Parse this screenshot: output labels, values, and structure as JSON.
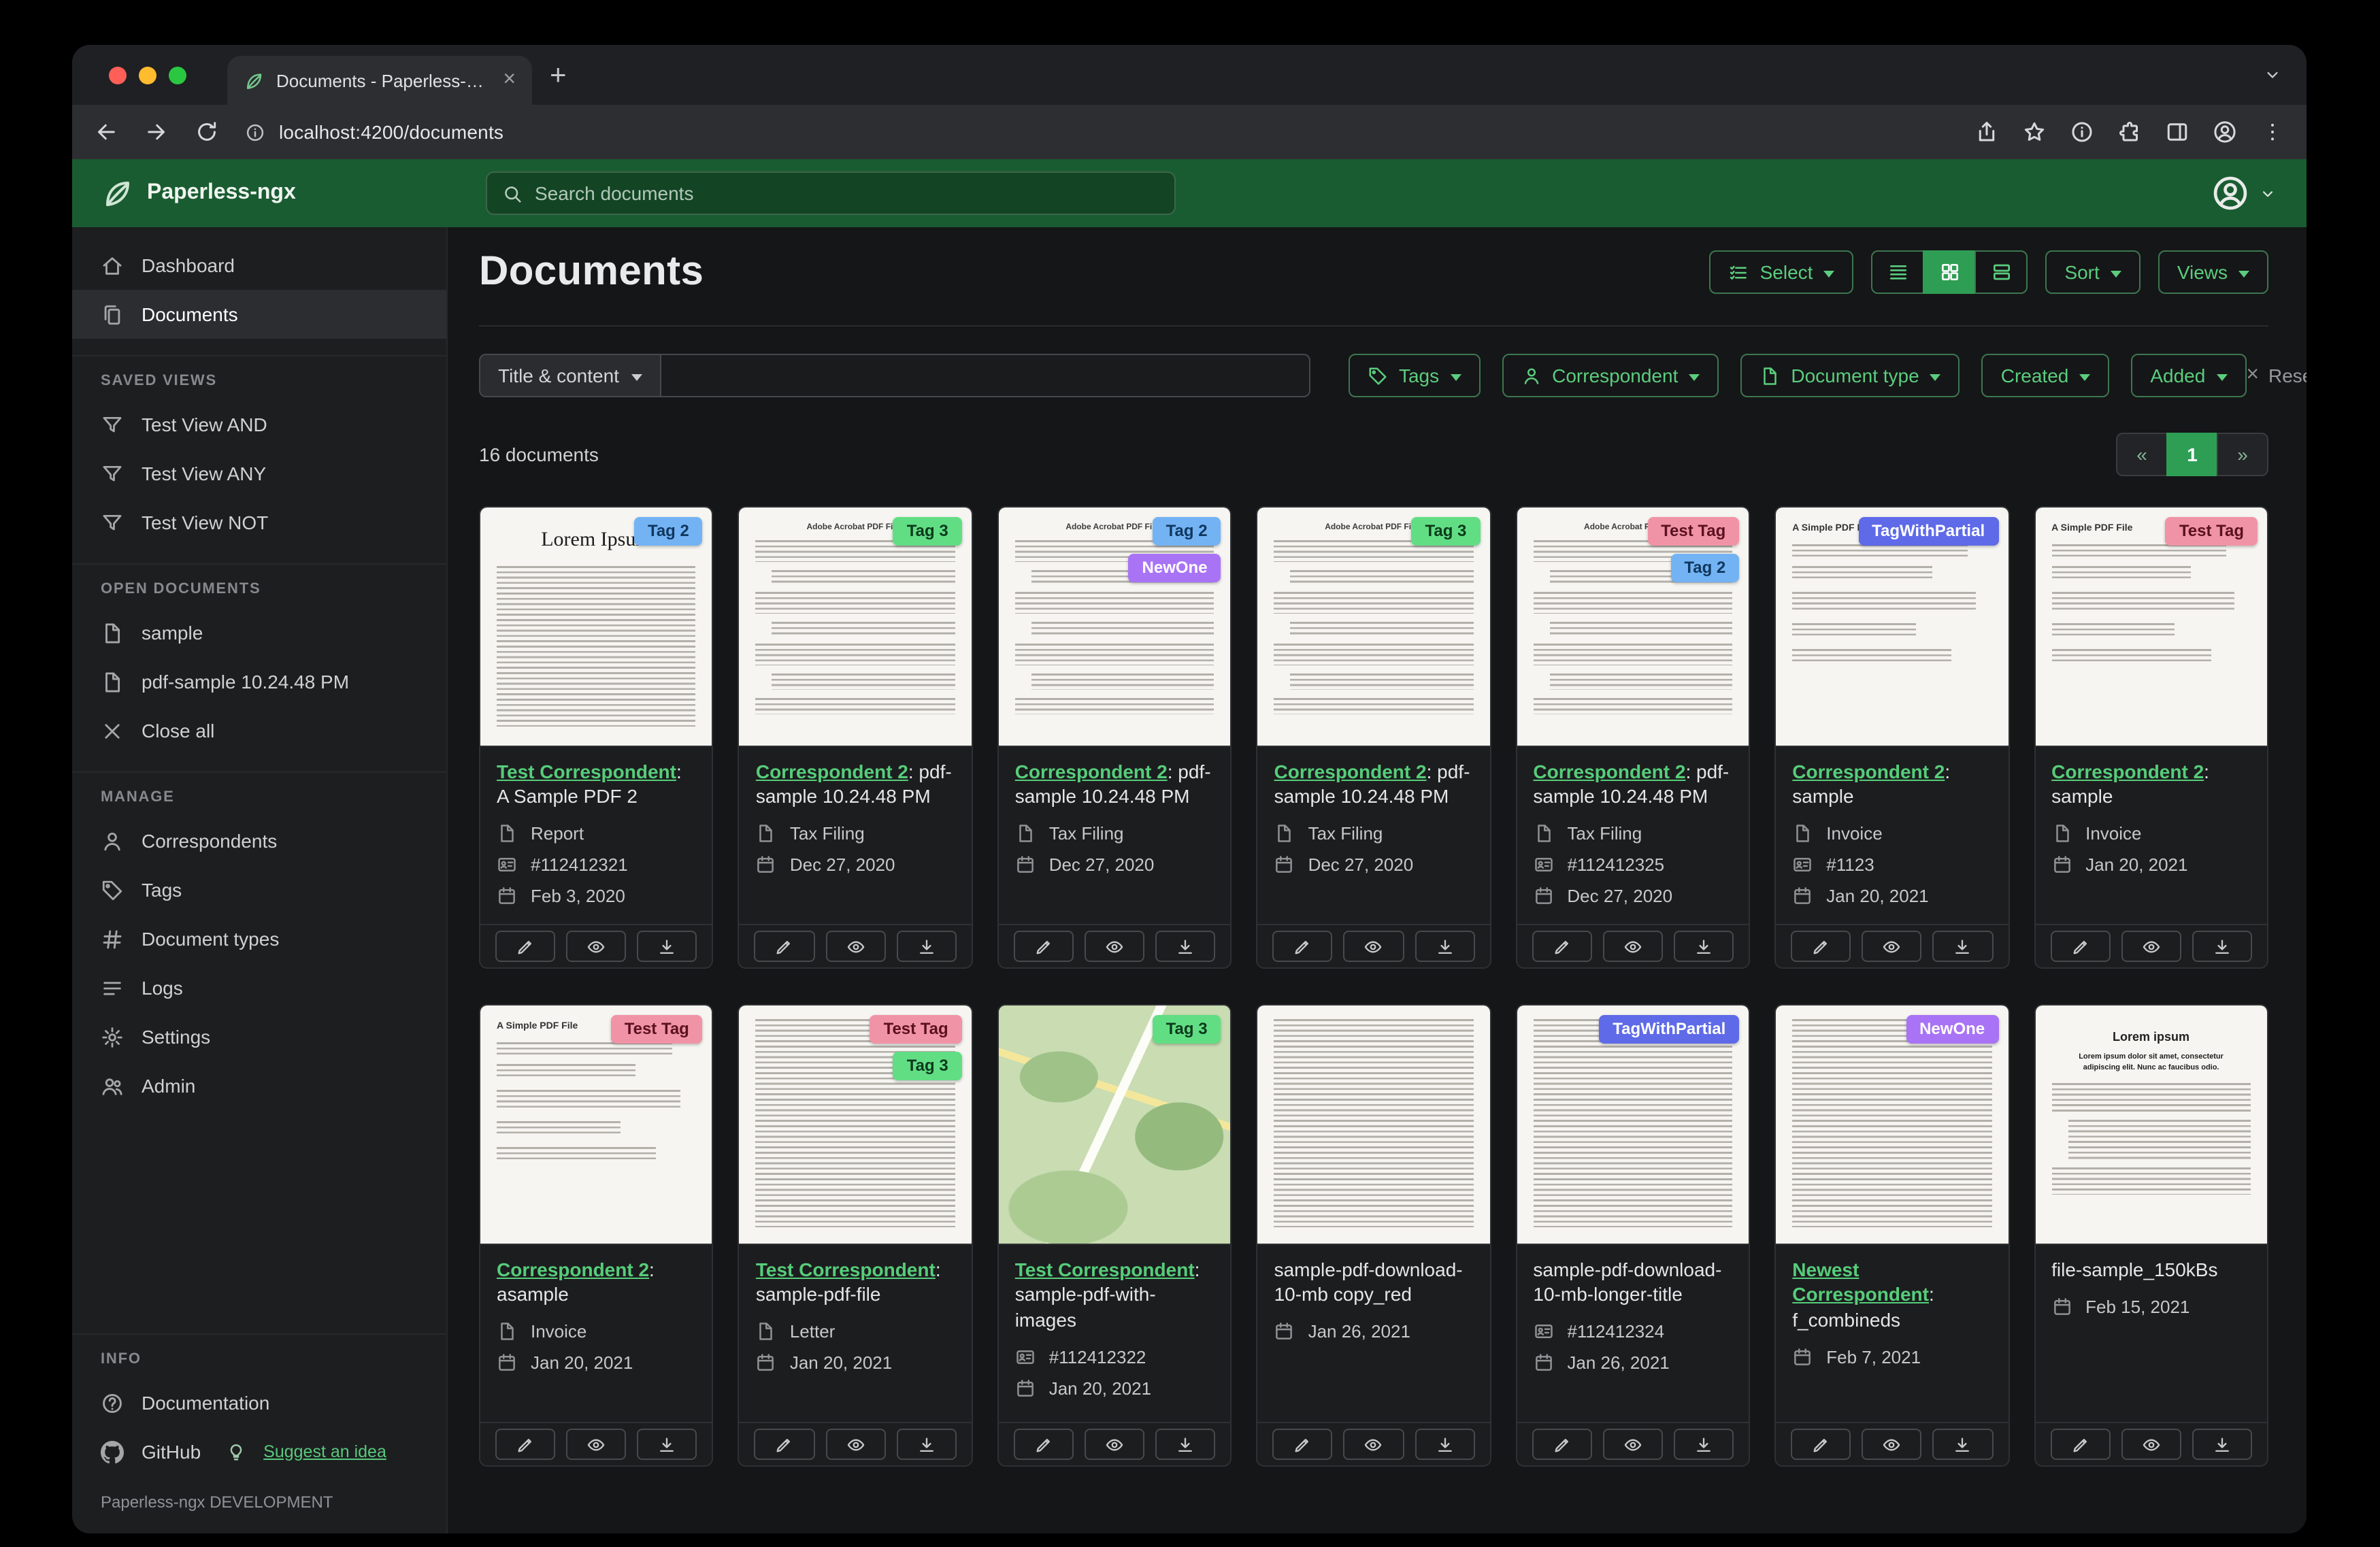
{
  "browser": {
    "tab_title": "Documents - Paperless-ngx",
    "url": "localhost:4200/documents"
  },
  "app_header": {
    "brand": "Paperless-ngx",
    "search_placeholder": "Search documents"
  },
  "sidebar": {
    "nav": [
      {
        "icon": "dashboard-icon",
        "label": "Dashboard",
        "active": false
      },
      {
        "icon": "documents-icon",
        "label": "Documents",
        "active": true
      }
    ],
    "sections": [
      {
        "title": "SAVED VIEWS",
        "items": [
          {
            "icon": "filter-icon",
            "label": "Test View AND"
          },
          {
            "icon": "filter-icon",
            "label": "Test View ANY"
          },
          {
            "icon": "filter-icon",
            "label": "Test View NOT"
          }
        ]
      },
      {
        "title": "OPEN DOCUMENTS",
        "items": [
          {
            "icon": "open-doc-icon",
            "label": "sample"
          },
          {
            "icon": "open-doc-icon",
            "label": "pdf-sample 10.24.48 PM"
          },
          {
            "icon": "close-icon",
            "label": "Close all"
          }
        ]
      },
      {
        "title": "MANAGE",
        "items": [
          {
            "icon": "person-icon",
            "label": "Correspondents"
          },
          {
            "icon": "tag-icon",
            "label": "Tags"
          },
          {
            "icon": "hash-icon",
            "label": "Document types"
          },
          {
            "icon": "logs-icon",
            "label": "Logs"
          },
          {
            "icon": "gear-icon",
            "label": "Settings"
          },
          {
            "icon": "admin-icon",
            "label": "Admin"
          }
        ]
      },
      {
        "title": "INFO",
        "items": [
          {
            "icon": "question-icon",
            "label": "Documentation"
          }
        ]
      }
    ],
    "github": {
      "label": "GitHub",
      "suggest_label": "Suggest an idea"
    },
    "footer": "Paperless-ngx DEVELOPMENT"
  },
  "main": {
    "title": "Documents",
    "toolbar": {
      "select_label": "Select",
      "sort_label": "Sort",
      "views_label": "Views"
    },
    "filters": {
      "field_button": "Title & content",
      "input_value": "",
      "buttons": [
        {
          "icon": "tags-icon",
          "label": "Tags"
        },
        {
          "icon": "correspondent-icon",
          "label": "Correspondent"
        },
        {
          "icon": "doctype-icon",
          "label": "Document type"
        },
        {
          "icon": "",
          "label": "Created"
        },
        {
          "icon": "",
          "label": "Added"
        }
      ],
      "reset_label": "Reset filters"
    },
    "count_text": "16 documents",
    "pagination": {
      "prev": "«",
      "page": "1",
      "next": "»"
    }
  },
  "tag_colors": {
    "Tag 2": {
      "bg": "#73b3f4",
      "fg": "#10375e"
    },
    "Tag 3": {
      "bg": "#61de84",
      "fg": "#0c3a1c"
    },
    "NewOne": {
      "bg": "#a973f6",
      "fg": "#ffffff"
    },
    "Test Tag": {
      "bg": "#f193a6",
      "fg": "#5a1120"
    },
    "TagWithPartial": {
      "bg": "#5e6ae8",
      "fg": "#ffffff"
    }
  },
  "documents": [
    {
      "tags": [
        "Tag 2"
      ],
      "thumb": {
        "variant": "lorem",
        "title": "Lorem Ipsum"
      },
      "title_link": "Test Correspondent",
      "title_rest": ": A Sample PDF 2",
      "fields": [
        {
          "kind": "type",
          "icon": "doctype-icon",
          "text": "Report"
        },
        {
          "kind": "asn",
          "icon": "asn-icon",
          "text": "#112412321"
        },
        {
          "kind": "date",
          "icon": "calendar-icon",
          "text": "Feb 3, 2020"
        }
      ]
    },
    {
      "tags": [
        "Tag 3"
      ],
      "thumb": {
        "variant": "adobe",
        "title": "Adobe Acrobat PDF Files"
      },
      "title_link": "Correspondent 2",
      "title_rest": ": pdf-sample 10.24.48 PM",
      "fields": [
        {
          "kind": "type",
          "icon": "doctype-icon",
          "text": "Tax Filing"
        },
        {
          "kind": "date",
          "icon": "calendar-icon",
          "text": "Dec 27, 2020"
        }
      ]
    },
    {
      "tags": [
        "Tag 2",
        "NewOne"
      ],
      "thumb": {
        "variant": "adobe",
        "title": "Adobe Acrobat PDF Files"
      },
      "title_link": "Correspondent 2",
      "title_rest": ": pdf-sample 10.24.48 PM",
      "fields": [
        {
          "kind": "type",
          "icon": "doctype-icon",
          "text": "Tax Filing"
        },
        {
          "kind": "date",
          "icon": "calendar-icon",
          "text": "Dec 27, 2020"
        }
      ]
    },
    {
      "tags": [
        "Tag 3"
      ],
      "thumb": {
        "variant": "adobe",
        "title": "Adobe Acrobat PDF Files"
      },
      "title_link": "Correspondent 2",
      "title_rest": ": pdf-sample 10.24.48 PM",
      "fields": [
        {
          "kind": "type",
          "icon": "doctype-icon",
          "text": "Tax Filing"
        },
        {
          "kind": "date",
          "icon": "calendar-icon",
          "text": "Dec 27, 2020"
        }
      ]
    },
    {
      "tags": [
        "Test Tag",
        "Tag 2"
      ],
      "thumb": {
        "variant": "adobe",
        "title": "Adobe Acrobat PDF Files"
      },
      "title_link": "Correspondent 2",
      "title_rest": ": pdf-sample 10.24.48 PM",
      "fields": [
        {
          "kind": "type",
          "icon": "doctype-icon",
          "text": "Tax Filing"
        },
        {
          "kind": "asn",
          "icon": "asn-icon",
          "text": "#112412325"
        },
        {
          "kind": "date",
          "icon": "calendar-icon",
          "text": "Dec 27, 2020"
        }
      ]
    },
    {
      "tags": [
        "TagWithPartial"
      ],
      "thumb": {
        "variant": "simple",
        "title": "A Simple PDF File"
      },
      "title_link": "Correspondent 2",
      "title_rest": ": sample",
      "fields": [
        {
          "kind": "type",
          "icon": "doctype-icon",
          "text": "Invoice"
        },
        {
          "kind": "asn",
          "icon": "asn-icon",
          "text": "#1123"
        },
        {
          "kind": "date",
          "icon": "calendar-icon",
          "text": "Jan 20, 2021"
        }
      ]
    },
    {
      "tags": [
        "Test Tag"
      ],
      "thumb": {
        "variant": "simple",
        "title": "A Simple PDF File"
      },
      "title_link": "Correspondent 2",
      "title_rest": ": sample",
      "fields": [
        {
          "kind": "type",
          "icon": "doctype-icon",
          "text": "Invoice"
        },
        {
          "kind": "date",
          "icon": "calendar-icon",
          "text": "Jan 20, 2021"
        }
      ]
    },
    {
      "tags": [
        "Test Tag"
      ],
      "thumb": {
        "variant": "simple",
        "title": "A Simple PDF File"
      },
      "title_link": "Correspondent 2",
      "title_rest": ": asample",
      "fields": [
        {
          "kind": "type",
          "icon": "doctype-icon",
          "text": "Invoice"
        },
        {
          "kind": "date",
          "icon": "calendar-icon",
          "text": "Jan 20, 2021"
        }
      ]
    },
    {
      "tags": [
        "Test Tag",
        "Tag 3"
      ],
      "thumb": {
        "variant": "dense",
        "title": ""
      },
      "title_link": "Test Correspondent",
      "title_rest": ": sample-pdf-file",
      "fields": [
        {
          "kind": "type",
          "icon": "doctype-icon",
          "text": "Letter"
        },
        {
          "kind": "date",
          "icon": "calendar-icon",
          "text": "Jan 20, 2021"
        }
      ]
    },
    {
      "tags": [
        "Tag 3"
      ],
      "thumb": {
        "variant": "map",
        "title": ""
      },
      "title_link": "Test Correspondent",
      "title_rest": ": sample-pdf-with-images",
      "fields": [
        {
          "kind": "asn",
          "icon": "asn-icon",
          "text": "#112412322"
        },
        {
          "kind": "date",
          "icon": "calendar-icon",
          "text": "Jan 20, 2021"
        }
      ]
    },
    {
      "tags": [],
      "thumb": {
        "variant": "dense",
        "title": ""
      },
      "title_link": "",
      "title_rest": "sample-pdf-download-10-mb copy_red",
      "fields": [
        {
          "kind": "date",
          "icon": "calendar-icon",
          "text": "Jan 26, 2021"
        }
      ]
    },
    {
      "tags": [
        "TagWithPartial"
      ],
      "thumb": {
        "variant": "dense",
        "title": ""
      },
      "title_link": "",
      "title_rest": "sample-pdf-download-10-mb-longer-title",
      "fields": [
        {
          "kind": "asn",
          "icon": "asn-icon",
          "text": "#112412324"
        },
        {
          "kind": "date",
          "icon": "calendar-icon",
          "text": "Jan 26, 2021"
        }
      ]
    },
    {
      "tags": [
        "NewOne"
      ],
      "thumb": {
        "variant": "dense",
        "title": ""
      },
      "title_link": "Newest Correspondent",
      "title_rest": ": f_combineds",
      "fields": [
        {
          "kind": "date",
          "icon": "calendar-icon",
          "text": "Feb 7, 2021"
        }
      ]
    },
    {
      "tags": [],
      "thumb": {
        "variant": "lorem2",
        "title": "Lorem ipsum",
        "subtitle": "Lorem ipsum dolor sit amet, consectetur adipiscing elit. Nunc ac faucibus odio."
      },
      "title_link": "",
      "title_rest": "file-sample_150kBs",
      "fields": [
        {
          "kind": "date",
          "icon": "calendar-icon",
          "text": "Feb 15, 2021"
        }
      ]
    }
  ]
}
